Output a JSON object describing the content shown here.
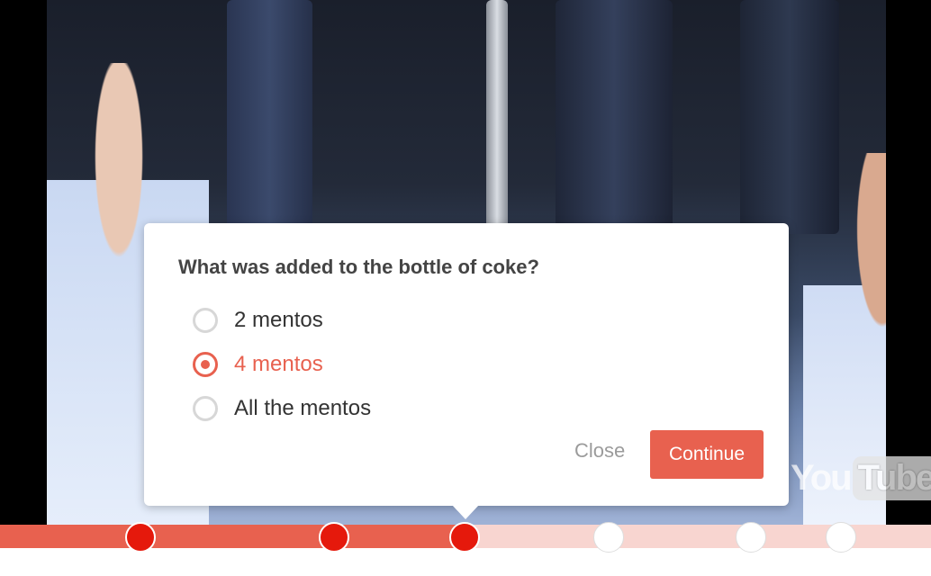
{
  "video": {
    "watermark_part1": "You",
    "watermark_part2": "Tube"
  },
  "quiz": {
    "question": "What was added to the bottle of coke?",
    "options": [
      {
        "label": "2 mentos",
        "selected": false
      },
      {
        "label": "4 mentos",
        "selected": true
      },
      {
        "label": "All the mentos",
        "selected": false
      }
    ],
    "close_label": "Close",
    "continue_label": "Continue"
  },
  "timeline": {
    "progress_fraction": 0.5,
    "markers": [
      "answered",
      "answered",
      "current",
      "unanswered",
      "unanswered",
      "unanswered"
    ]
  },
  "colors": {
    "accent": "#e8614f",
    "marker_done": "#e5190c",
    "track_remaining": "#f8d5d0"
  }
}
